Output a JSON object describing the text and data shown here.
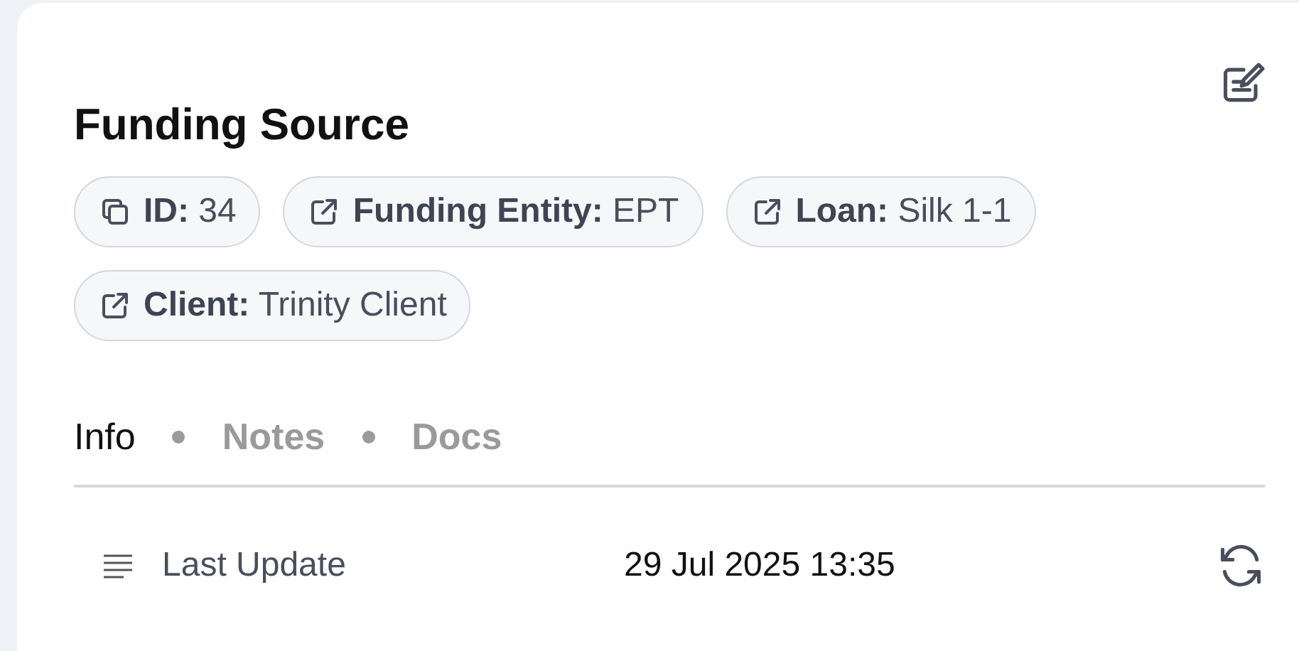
{
  "title": "Funding Source",
  "chips": [
    {
      "kind": "copy",
      "label": "ID:",
      "value": "34"
    },
    {
      "kind": "link",
      "label": "Funding Entity:",
      "value": "EPT"
    },
    {
      "kind": "link",
      "label": "Loan:",
      "value": "Silk 1-1"
    },
    {
      "kind": "link",
      "label": "Client:",
      "value": "Trinity Client"
    }
  ],
  "tabs": [
    {
      "label": "Info",
      "selected": true
    },
    {
      "label": "Notes",
      "selected": false
    },
    {
      "label": "Docs",
      "selected": false
    }
  ],
  "fields": [
    {
      "label": "Last Update",
      "value": "29 Jul 2025 13:35"
    }
  ]
}
